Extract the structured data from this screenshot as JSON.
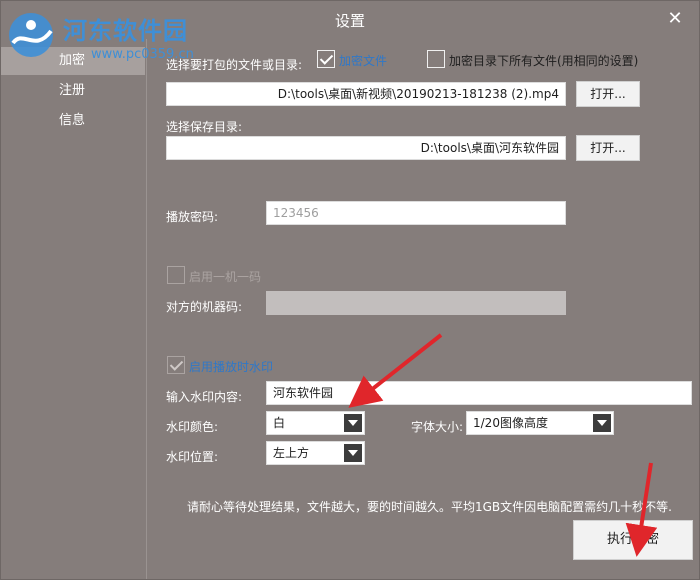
{
  "window": {
    "title": "设置",
    "close_label": "✕"
  },
  "watermark": {
    "name": "河东软件园",
    "url": "www.pc0359.cn"
  },
  "sidebar": {
    "items": [
      {
        "label": "加密"
      },
      {
        "label": "注册"
      },
      {
        "label": "信息"
      }
    ]
  },
  "form": {
    "source_label": "选择要打包的文件或目录:",
    "encrypt_file": {
      "label": "加密文件",
      "checked": true
    },
    "encrypt_dir_all": {
      "label": "加密目录下所有文件(用相同的设置)",
      "checked": false
    },
    "source_path": "D:\\tools\\桌面\\新视频\\20190213-181238 (2).mp4",
    "open_label": "打开...",
    "save_label": "选择保存目录:",
    "save_path": "D:\\tools\\桌面\\河东软件园",
    "play_password_label": "播放密码:",
    "play_password_value": "123456",
    "one_machine": {
      "label": "启用一机一码",
      "checked": false
    },
    "peer_machine_label": "对方的机器码:",
    "peer_machine_value": "",
    "watermark_enable": {
      "label": "启用播放时水印",
      "checked": true
    },
    "watermark_content_label": "输入水印内容:",
    "watermark_content_value": "河东软件园",
    "watermark_color_label": "水印颜色:",
    "watermark_color_value": "白",
    "font_size_label": "字体大小:",
    "font_size_value": "1/20图像高度",
    "watermark_position_label": "水印位置:",
    "watermark_position_value": "左上方",
    "note": "请耐心等待处理结果，文件越大，要的时间越久。平均1GB文件因电脑配置需约几十秒不等.",
    "execute_label": "执行加密"
  },
  "colors": {
    "background": "#857d7b",
    "watermark_blue": "#3f8fd6",
    "checkbox_label_blue": "#2f78c8",
    "annotation_arrow": "#e0262b"
  }
}
